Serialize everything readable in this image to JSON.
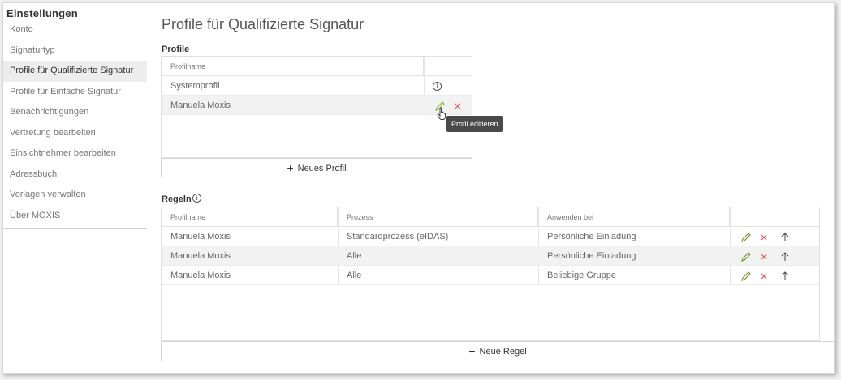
{
  "sidebar": {
    "title": "Einstellungen",
    "items": [
      {
        "label": "Konto"
      },
      {
        "label": "Signaturtyp"
      },
      {
        "label": "Profile für Qualifizierte Signatur"
      },
      {
        "label": "Profile für Einfache Signatur"
      },
      {
        "label": "Benachrichtigungen"
      },
      {
        "label": "Vertretung bearbeiten"
      },
      {
        "label": "Einsichtnehmer bearbeiten"
      },
      {
        "label": "Adressbuch"
      },
      {
        "label": "Vorlagen verwalten"
      },
      {
        "label": "Über MOXIS"
      }
    ]
  },
  "page": {
    "title": "Profile für Qualifizierte Signatur"
  },
  "profiles": {
    "section_title": "Profile",
    "column_header": "Profilname",
    "rows": [
      {
        "name": "Systemprofil"
      },
      {
        "name": "Manuela Moxis"
      }
    ],
    "tooltip": "Profil editieren",
    "new_button": "Neues Profil"
  },
  "rules": {
    "section_title": "Regeln",
    "columns": [
      "Profilname",
      "Prozess",
      "Anwenden bei"
    ],
    "rows": [
      {
        "profile": "Manuela Moxis",
        "process": "Standardprozess (eIDAS)",
        "apply": "Persönliche Einladung"
      },
      {
        "profile": "Manuela Moxis",
        "process": "Alle",
        "apply": "Persönliche Einladung"
      },
      {
        "profile": "Manuela Moxis",
        "process": "Alle",
        "apply": "Beliebige Gruppe"
      }
    ],
    "new_button": "Neue Regel"
  },
  "icons": {
    "plus": "+",
    "info": "i",
    "edit": "pencil-icon",
    "delete": "close-icon",
    "move": "arrow-up-icon",
    "cursor": "hand-pointer-icon"
  },
  "colors": {
    "edit": "#6b8e23",
    "delete": "#e05555",
    "active_row": "#ededed",
    "tooltip_bg": "#4a4a4a"
  }
}
